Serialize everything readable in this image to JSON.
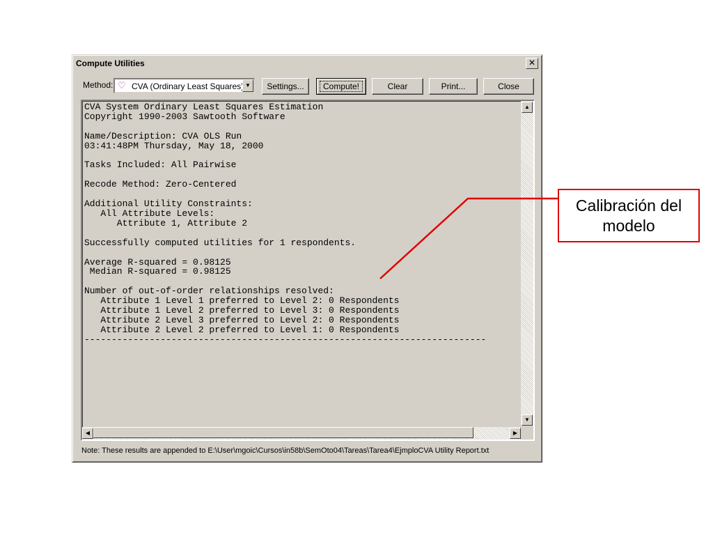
{
  "window": {
    "title": "Compute Utilities",
    "close_glyph": "✕"
  },
  "toolbar": {
    "method_label": "Method:",
    "method_value": "CVA (Ordinary Least Squares)",
    "method_icon": "cva-heart-icon",
    "buttons": {
      "settings": "Settings...",
      "compute": "Compute!",
      "clear": "Clear",
      "print": "Print...",
      "close": "Close"
    }
  },
  "output": {
    "text": "CVA System Ordinary Least Squares Estimation\nCopyright 1990-2003 Sawtooth Software\n\nName/Description: CVA OLS Run\n03:41:48PM Thursday, May 18, 2000\n\nTasks Included: All Pairwise\n\nRecode Method: Zero-Centered\n\nAdditional Utility Constraints:\n   All Attribute Levels:\n      Attribute 1, Attribute 2\n\nSuccessfully computed utilities for 1 respondents.\n\nAverage R-squared = 0.98125\n Median R-squared = 0.98125\n\nNumber of out-of-order relationships resolved:\n   Attribute 1 Level 1 preferred to Level 2: 0 Respondents\n   Attribute 1 Level 2 preferred to Level 3: 0 Respondents\n   Attribute 2 Level 3 preferred to Level 2: 0 Respondents\n   Attribute 2 Level 2 preferred to Level 1: 0 Respondents\n--------------------------------------------------------------------------"
  },
  "footer": {
    "note": "Note: These results are appended to E:\\User\\mgoic\\Cursos\\in58b\\SemOto04\\Tareas\\Tarea4\\EjmploCVA Utility Report.txt"
  },
  "callout": {
    "line1": "Calibración del",
    "line2": "modelo",
    "color": "#e00000"
  }
}
